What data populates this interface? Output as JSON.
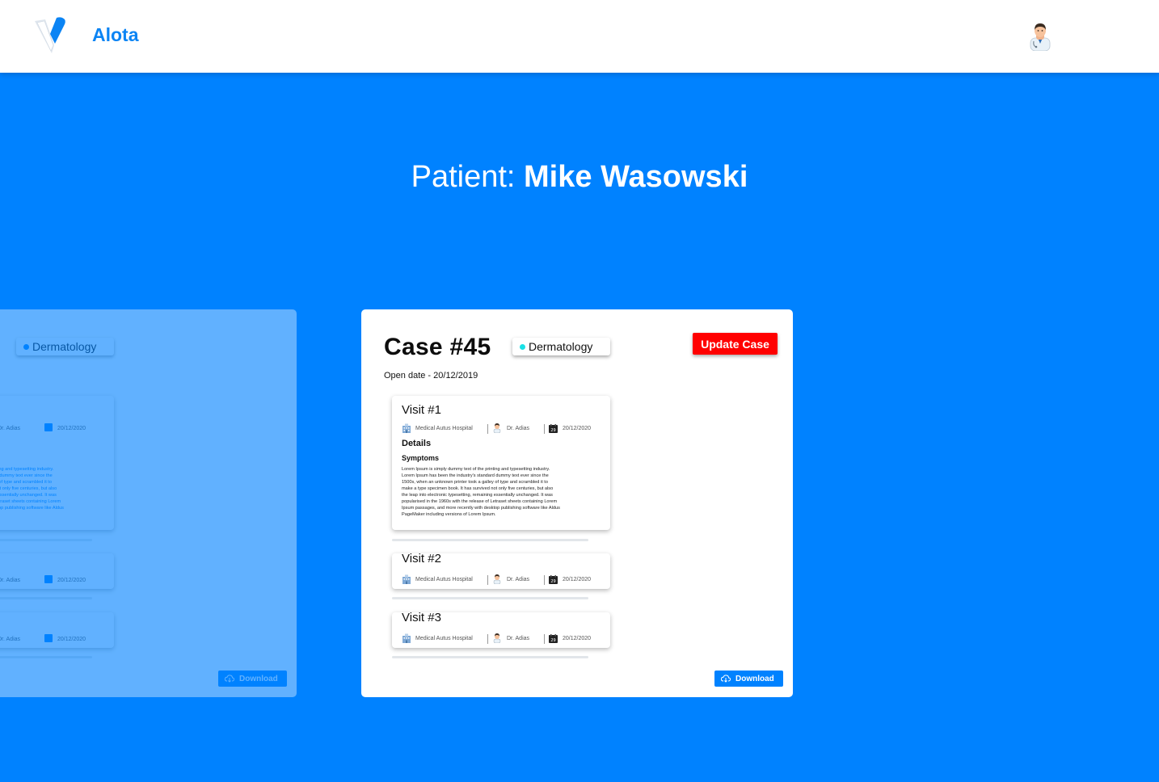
{
  "header": {
    "brand": "Alota",
    "logo_icon": "alota-v-logo",
    "user_icon": "doctor-avatar-icon"
  },
  "patient": {
    "label": "Patient:",
    "name": "Mike Wasowski"
  },
  "case": {
    "title": "Case #45",
    "specialty": "Dermatology",
    "specialty_dot_color": "#19e1e6",
    "update_label": "Update Case",
    "open_date": "Open date - 20/12/2019",
    "download_label": "Download",
    "visits": [
      {
        "title": "Visit #1",
        "hospital": "Medical Autus Hospital",
        "doctor": "Dr. Adias",
        "date": "20/12/2020",
        "details_label": "Details",
        "symptoms_label": "Symptoms",
        "symptoms_text": "Lorem Ipsum is simply dummy text of the printing and typesetting industry. Lorem Ipsum has been the industry's standard dummy text ever since the 1500s, when an unknown printer took a galley of type and scrambled it to make a type specimen book. It has survived not only five centuries, but also the leap into electronic typesetting, remaining essentially unchanged. It was popularised in the 1960s with the release of Letraset sheets containing Lorem Ipsum passages, and more recently with desktop publishing software like Aldus PageMaker including versions of Lorem Ipsum."
      },
      {
        "title": "Visit #2",
        "hospital": "Medical Autus Hospital",
        "doctor": "Dr. Adias",
        "date": "20/12/2020"
      },
      {
        "title": "Visit #3",
        "hospital": "Medical Autus Hospital",
        "doctor": "Dr. Adias",
        "date": "20/12/2020"
      }
    ]
  },
  "colors": {
    "background": "#0082ff",
    "update_button": "#ff0000",
    "download_button": "#0082ff",
    "brand": "#0b84f4"
  }
}
